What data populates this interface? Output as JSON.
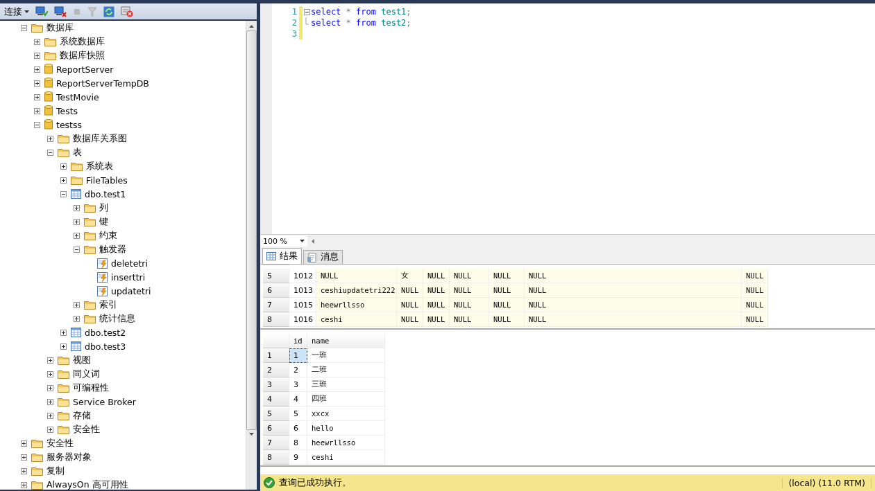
{
  "toolbar": {
    "connect_label": "连接"
  },
  "tree": [
    {
      "label": "数据库",
      "kind": "folder",
      "expanded": true,
      "children": [
        {
          "label": "系统数据库",
          "kind": "folder",
          "expanded": false
        },
        {
          "label": "数据库快照",
          "kind": "folder",
          "expanded": false
        },
        {
          "label": "ReportServer",
          "kind": "database",
          "expanded": false
        },
        {
          "label": "ReportServerTempDB",
          "kind": "database",
          "expanded": false
        },
        {
          "label": "TestMovie",
          "kind": "database",
          "expanded": false
        },
        {
          "label": "Tests",
          "kind": "database",
          "expanded": false
        },
        {
          "label": "testss",
          "kind": "database",
          "expanded": true,
          "children": [
            {
              "label": "数据库关系图",
              "kind": "folder",
              "expanded": false
            },
            {
              "label": "表",
              "kind": "folder",
              "expanded": true,
              "children": [
                {
                  "label": "系统表",
                  "kind": "folder",
                  "expanded": false
                },
                {
                  "label": "FileTables",
                  "kind": "folder",
                  "expanded": false
                },
                {
                  "label": "dbo.test1",
                  "kind": "table",
                  "expanded": true,
                  "children": [
                    {
                      "label": "列",
                      "kind": "folder",
                      "expanded": false
                    },
                    {
                      "label": "键",
                      "kind": "folder",
                      "expanded": false
                    },
                    {
                      "label": "约束",
                      "kind": "folder",
                      "expanded": false
                    },
                    {
                      "label": "触发器",
                      "kind": "folder",
                      "expanded": true,
                      "children": [
                        {
                          "label": "deletetri",
                          "kind": "trigger"
                        },
                        {
                          "label": "inserttri",
                          "kind": "trigger"
                        },
                        {
                          "label": "updatetri",
                          "kind": "trigger"
                        }
                      ]
                    },
                    {
                      "label": "索引",
                      "kind": "folder",
                      "expanded": false
                    },
                    {
                      "label": "统计信息",
                      "kind": "folder",
                      "expanded": false
                    }
                  ]
                },
                {
                  "label": "dbo.test2",
                  "kind": "table",
                  "expanded": false
                },
                {
                  "label": "dbo.test3",
                  "kind": "table",
                  "expanded": false
                }
              ]
            },
            {
              "label": "视图",
              "kind": "folder",
              "expanded": false
            },
            {
              "label": "同义词",
              "kind": "folder",
              "expanded": false
            },
            {
              "label": "可编程性",
              "kind": "folder",
              "expanded": false
            },
            {
              "label": "Service Broker",
              "kind": "folder",
              "expanded": false
            },
            {
              "label": "存储",
              "kind": "folder",
              "expanded": false
            },
            {
              "label": "安全性",
              "kind": "folder",
              "expanded": false
            }
          ]
        }
      ]
    },
    {
      "label": "安全性",
      "kind": "folder",
      "expanded": false
    },
    {
      "label": "服务器对象",
      "kind": "folder",
      "expanded": false
    },
    {
      "label": "复制",
      "kind": "folder",
      "expanded": false
    },
    {
      "label": "AlwaysOn 高可用性",
      "kind": "folder",
      "expanded": false
    }
  ],
  "editor": {
    "lines": [
      {
        "number": "1",
        "tokens": [
          {
            "text": "select",
            "kind": "keyword"
          },
          {
            "text": "*",
            "kind": "operator"
          },
          {
            "text": "from",
            "kind": "keyword"
          },
          {
            "text": "test1",
            "kind": "name"
          },
          {
            "text": ";",
            "kind": "operator"
          }
        ]
      },
      {
        "number": "2",
        "tokens": [
          {
            "text": "select",
            "kind": "keyword"
          },
          {
            "text": "*",
            "kind": "operator"
          },
          {
            "text": "from",
            "kind": "keyword"
          },
          {
            "text": "test2",
            "kind": "name"
          },
          {
            "text": ";",
            "kind": "operator"
          }
        ]
      },
      {
        "number": "3"
      }
    ]
  },
  "zoom": "100 %",
  "tabs": [
    {
      "label": "结果",
      "selected": true
    },
    {
      "label": "消息",
      "selected": false
    }
  ],
  "grid_1": {
    "rows": [
      [
        "5",
        "1012",
        "NULL",
        "女",
        "NULL",
        "NULL",
        "NULL",
        "NULL",
        "NULL"
      ],
      [
        "6",
        "1013",
        "ceshiupdatetri222",
        "NULL",
        "NULL",
        "NULL",
        "NULL",
        "NULL",
        "NULL"
      ],
      [
        "7",
        "1015",
        "heewrllsso",
        "NULL",
        "NULL",
        "NULL",
        "NULL",
        "NULL",
        "NULL"
      ],
      [
        "8",
        "1016",
        "ceshi",
        "NULL",
        "NULL",
        "NULL",
        "NULL",
        "NULL",
        "NULL"
      ]
    ]
  },
  "grid_2": {
    "columns": [
      "id",
      "name"
    ],
    "rows": [
      {
        "number": "1",
        "id": "1",
        "name": "一班",
        "selected": true
      },
      {
        "number": "2",
        "id": "2",
        "name": "二班",
        "selected": false
      },
      {
        "number": "3",
        "id": "3",
        "name": "三班",
        "selected": false
      },
      {
        "number": "4",
        "id": "4",
        "name": "四班",
        "selected": false
      },
      {
        "number": "5",
        "id": "5",
        "name": "xxcx",
        "selected": false
      },
      {
        "number": "6",
        "id": "6",
        "name": "hello",
        "selected": false
      },
      {
        "number": "7",
        "id": "8",
        "name": "heewrllsso",
        "selected": false
      },
      {
        "number": "8",
        "id": "9",
        "name": "ceshi",
        "selected": false
      }
    ]
  },
  "status_bar": {
    "message": "查询已成功执行。",
    "server": "(local) (11.0 RTM)"
  }
}
